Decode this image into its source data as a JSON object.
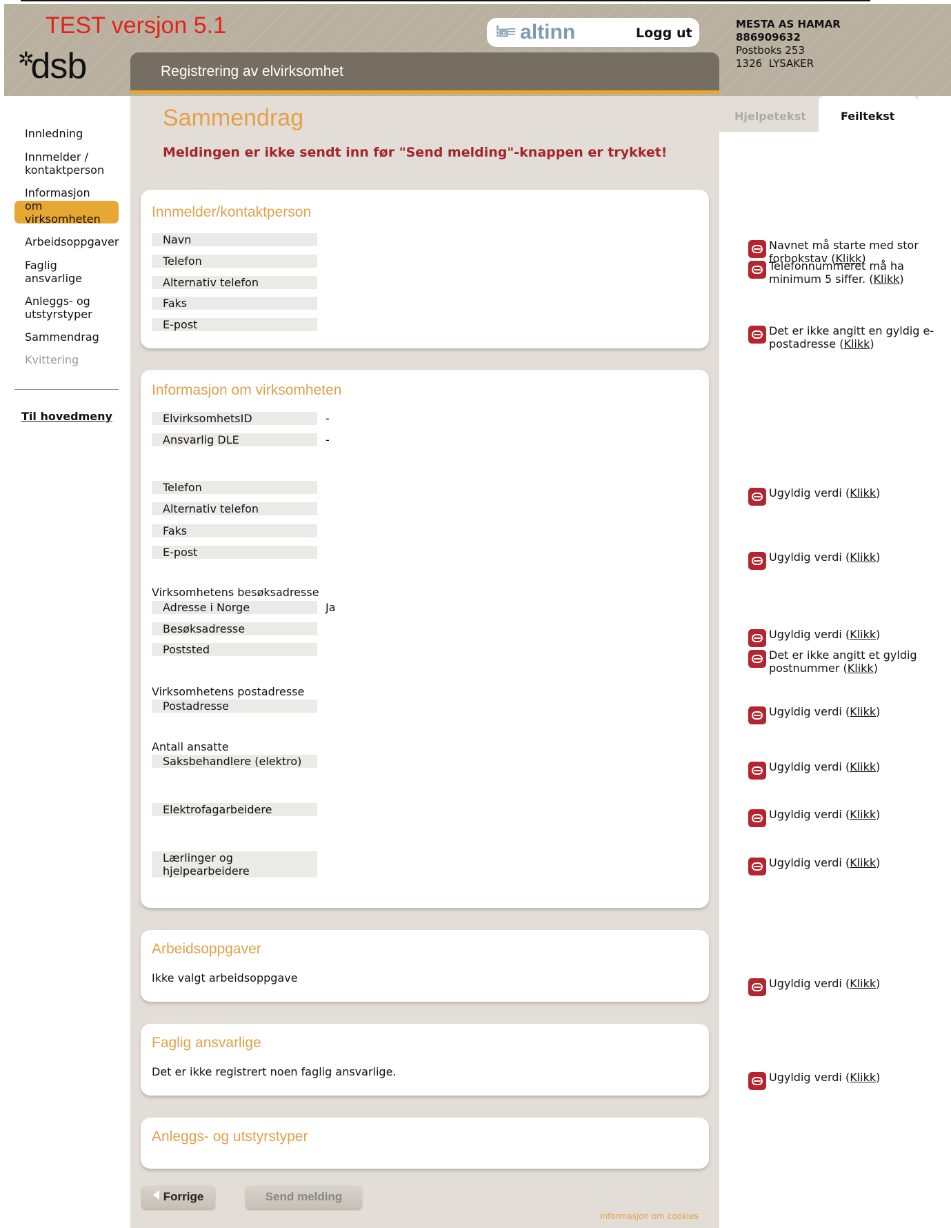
{
  "header": {
    "test_version": "TEST versjon 5.1",
    "logo_text": "dsb",
    "altinn_label": "altinn",
    "logout": "Logg ut",
    "app_title": "Registrering av elvirksomhet"
  },
  "org": {
    "name": "MESTA AS HAMAR",
    "number": "886909632",
    "address_line1": "Postboks 253",
    "address_line2": "1326  LYSAKER"
  },
  "nav": {
    "items": [
      {
        "label": "Innledning"
      },
      {
        "label": "Innmelder / kontaktperson"
      },
      {
        "label": "Informasjon om virksomheten"
      },
      {
        "label": "Arbeidsoppgaver"
      },
      {
        "label": "Faglig ansvarlige"
      },
      {
        "label": "Anleggs- og utstyrstyper"
      },
      {
        "label": "Sammendrag"
      },
      {
        "label": "Kvittering"
      }
    ],
    "main_menu": "Til hovedmeny"
  },
  "page": {
    "title": "Sammendrag",
    "warning": "Meldingen er ikke sendt inn før \"Send melding\"-knappen er trykket!"
  },
  "sections": {
    "contact": {
      "title": "Innmelder/kontaktperson",
      "fields": [
        "Navn",
        "Telefon",
        "Alternativ telefon",
        "Faks",
        "E-post"
      ]
    },
    "company": {
      "title": "Informasjon om virksomheten",
      "id_label": "ElvirksomhetsID",
      "id_value": "-",
      "dle_label": "Ansvarlig DLE",
      "dle_value": "-",
      "phone": "Telefon",
      "alt_phone": "Alternativ telefon",
      "fax": "Faks",
      "email": "E-post",
      "visit_heading": "Virksomhetens besøksadresse",
      "address_in_norway": "Adresse i Norge",
      "address_in_norway_value": "Ja",
      "visit_address": "Besøksadresse",
      "postal_place": "Poststed",
      "post_heading": "Virksomhetens postadresse",
      "post_address": "Postadresse",
      "employees_heading": "Antall ansatte",
      "case_handlers": "Saksbehandlere (elektro)",
      "electricians": "Elektrofagarbeidere",
      "apprentices_l1": "Lærlinger og",
      "apprentices_l2": "hjelpearbeidere"
    },
    "tasks": {
      "title": "Arbeidsoppgaver",
      "text": "Ikke valgt arbeidsoppgave"
    },
    "responsible": {
      "title": "Faglig ansvarlige",
      "text": "Det er ikke registrert noen faglig ansvarlige."
    },
    "equipment": {
      "title": "Anleggs- og utstyrstyper"
    }
  },
  "tabs": {
    "help": "Hjelpetekst",
    "errors": "Feiltekst"
  },
  "errors": {
    "name_error": "Navnet må starte med stor forbokstav",
    "phone_error": "Telefonnummeret må ha minimum 5 siffer.",
    "email_error": "Det er ikke angitt en gyldig e-postadresse",
    "invalid_value": "Ugyldig verdi",
    "postal_error": "Det er ikke angitt et gyldig postnummer",
    "link_text": "Klikk",
    "open_paren": "(",
    "close_paren": ")"
  },
  "buttons": {
    "prev": "Forrige",
    "send": "Send melding"
  },
  "footer": {
    "cookies": "Informasjon om cookies"
  },
  "colors": {
    "accent": "#e6a832",
    "header_bg": "#b9b0a0",
    "app_bar": "#766e62",
    "error_red": "#a4252c",
    "title_orange": "#e6a04a"
  }
}
